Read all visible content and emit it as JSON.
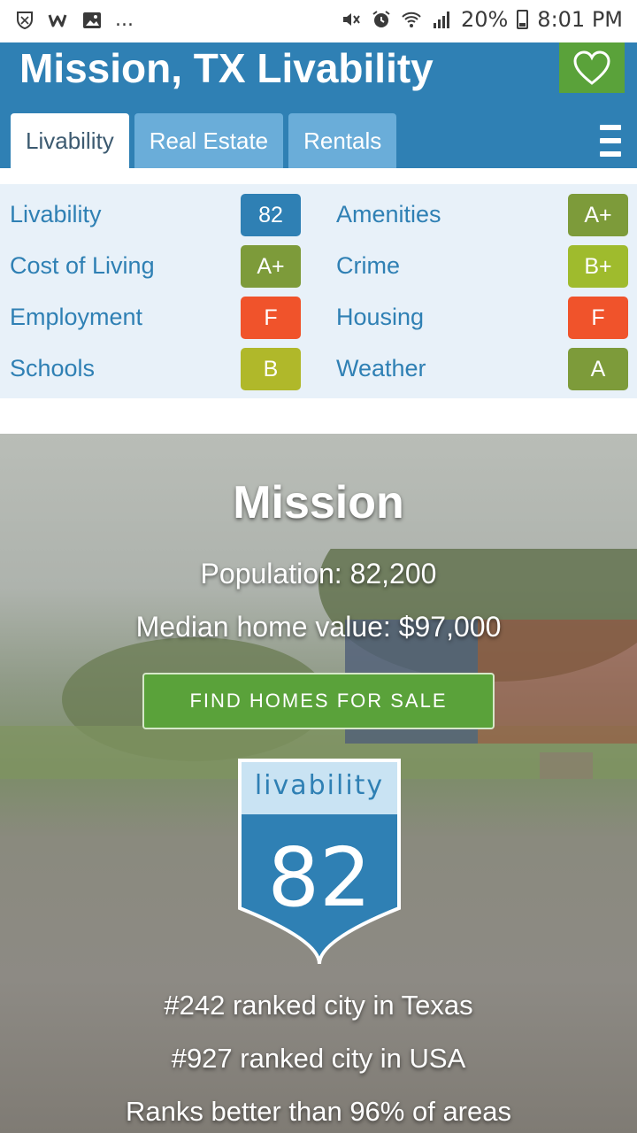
{
  "statusbar": {
    "left_icons": [
      "shield-icon",
      "wish-icon",
      "image-icon"
    ],
    "more": "...",
    "battery": "20%",
    "time": "8:01 PM"
  },
  "header": {
    "title": "Mission, TX Livability",
    "tabs": [
      {
        "label": "Livability",
        "active": true
      },
      {
        "label": "Real Estate",
        "active": false
      },
      {
        "label": "Rentals",
        "active": false
      }
    ],
    "fav_icon": "heart-icon",
    "menu_icon": "hamburger-icon"
  },
  "grades": {
    "left": [
      {
        "label": "Livability",
        "value": "82",
        "color": "#2f80b4"
      },
      {
        "label": "Cost of Living",
        "value": "A+",
        "color": "#7d9b3a"
      },
      {
        "label": "Employment",
        "value": "F",
        "color": "#f0532b"
      },
      {
        "label": "Schools",
        "value": "B",
        "color": "#b0b82a"
      }
    ],
    "right": [
      {
        "label": "Amenities",
        "value": "A+",
        "color": "#7d9b3a"
      },
      {
        "label": "Crime",
        "value": "B+",
        "color": "#9fbb2d"
      },
      {
        "label": "Housing",
        "value": "F",
        "color": "#f0532b"
      },
      {
        "label": "Weather",
        "value": "A",
        "color": "#7d9b3a"
      }
    ]
  },
  "hero": {
    "city": "Mission",
    "population": "Population: 82,200",
    "median_home_value": "Median home value: $97,000",
    "cta": "FIND HOMES FOR SALE",
    "badge_label": "livability",
    "badge_score": "82",
    "rank_state": "#242 ranked city in Texas",
    "rank_usa": "#927 ranked city in USA",
    "percentile": "Ranks better than 96% of areas"
  },
  "colors": {
    "brand_blue": "#2f80b4",
    "tab_inactive": "#6aadd9",
    "grade_panel": "#e8f1f9",
    "cta_green": "#5aa23a"
  }
}
